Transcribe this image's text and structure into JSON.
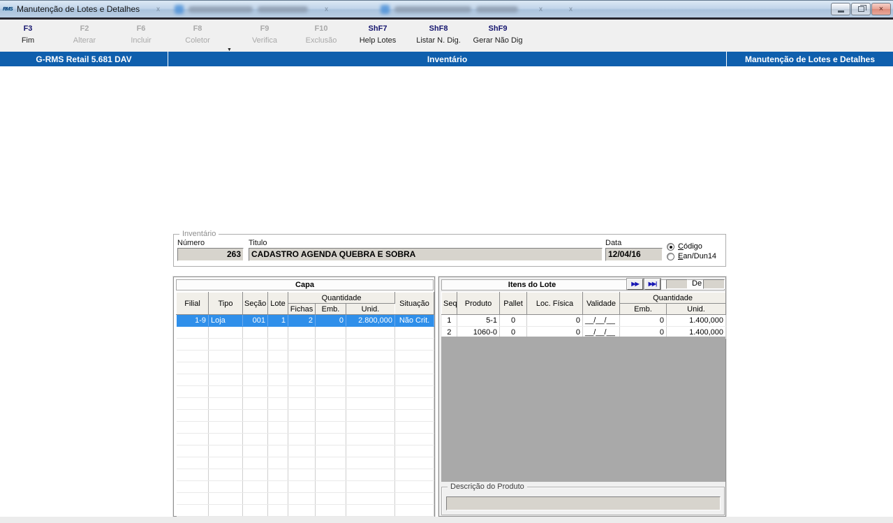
{
  "window": {
    "title": "Manutenção de Lotes e Detalhes",
    "icon": "rms-logo",
    "icon_text": "RMS",
    "controls": {
      "minimize_glyph": "",
      "restore_glyph": "",
      "close_glyph": "×"
    }
  },
  "toolbar": {
    "dropdown_glyph": "▼",
    "buttons": [
      {
        "key": "F3",
        "label": "Fim",
        "enabled": true
      },
      {
        "key": "F2",
        "label": "Alterar",
        "enabled": false
      },
      {
        "key": "F6",
        "label": "Incluir",
        "enabled": false
      },
      {
        "key": "F8",
        "label": "Coletor",
        "enabled": false
      },
      {
        "key": "F9",
        "label": "Verifica",
        "enabled": false
      },
      {
        "key": "F10",
        "label": "Exclusão",
        "enabled": false
      },
      {
        "key": "ShF7",
        "label": "Help Lotes",
        "enabled": true
      },
      {
        "key": "ShF8",
        "label": "Listar N. Dig.",
        "enabled": true
      },
      {
        "key": "ShF9",
        "label": "Gerar Não Dig",
        "enabled": true
      }
    ]
  },
  "header_bar": {
    "left": "G-RMS Retail 5.681 DAV",
    "center": "Inventário",
    "right": "Manutenção de Lotes e Detalhes",
    "color": "#0f5fad"
  },
  "inventario": {
    "group_label": "Inventário",
    "numero_label": "Número",
    "numero_value": "263",
    "titulo_label": "Titulo",
    "titulo_value": "CADASTRO AGENDA QUEBRA E SOBRA",
    "data_label": "Data",
    "data_value": "12/04/16",
    "radio_codigo": "Código",
    "radio_ean": "Ean/Dun14",
    "radio_selected": "Código"
  },
  "capa": {
    "title": "Capa",
    "quantidade_label": "Quantidade",
    "columns": [
      "Filial",
      "Tipo",
      "Seção",
      "Lote",
      "Fichas",
      "Emb.",
      "Unid.",
      "Situação"
    ],
    "selected_row_color": "#2f8fea",
    "rows": [
      {
        "filial": "1-9",
        "tipo": "Loja",
        "secao": "001",
        "lote": "1",
        "fichas": "2",
        "emb": "0",
        "unid": "2.800,000",
        "situacao": "Não Crit."
      }
    ]
  },
  "itens": {
    "title": "Itens do Lote",
    "quantidade_label": "Quantidade",
    "nav_next_glyph": "▶▶",
    "nav_last_glyph": "▶▶|",
    "de_label": "De",
    "de_from_value": "",
    "de_to_value": "",
    "columns": [
      "Seq",
      "Produto",
      "Pallet",
      "Loc. Física",
      "Validade",
      "Emb.",
      "Unid."
    ],
    "rows": [
      {
        "seq": "1",
        "produto": "5-1",
        "pallet": "0",
        "loc": "0",
        "validade": "__/__/__",
        "emb": "0",
        "unid": "1.400,000"
      },
      {
        "seq": "2",
        "produto": "1060-0",
        "pallet": "0",
        "loc": "0",
        "validade": "__/__/__",
        "emb": "0",
        "unid": "1.400,000"
      }
    ]
  },
  "descricao": {
    "group_label": "Descrição do Produto",
    "value": ""
  }
}
